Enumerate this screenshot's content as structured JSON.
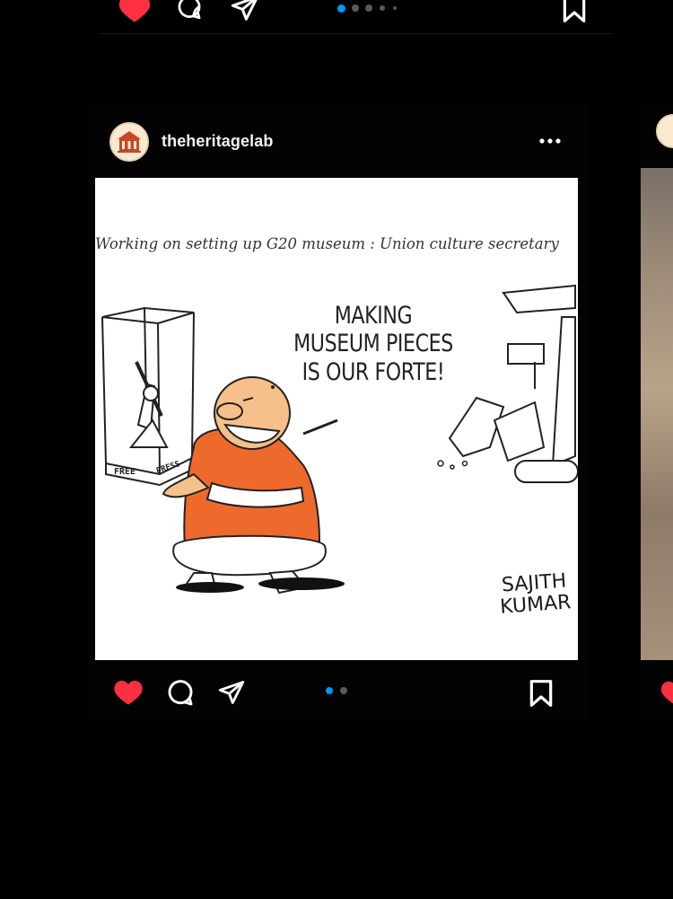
{
  "top_strip": {
    "icons": [
      "heart-icon",
      "comment-icon",
      "share-icon",
      "bookmark-icon"
    ],
    "carousel_dots": 5
  },
  "post": {
    "username": "theheritagelab",
    "menu_icon": "more-horizontal-icon",
    "image": {
      "headline": "Working on setting up G20 museum : Union culture secretary",
      "speech_bubble": [
        "MAKING",
        "MUSEUM PIECES",
        "IS OUR FORTE!"
      ],
      "box_labels": [
        "FREE",
        "PRESS"
      ],
      "signature": [
        "SAJITH",
        "KUMAR"
      ]
    },
    "actions": {
      "like_icon": "heart-filled-icon",
      "comment_icon": "comment-icon",
      "share_icon": "send-icon",
      "save_icon": "bookmark-icon"
    },
    "carousel_dots": 2,
    "active_dot": 0
  },
  "colors": {
    "background": "#000000",
    "like_red": "#ff3040",
    "dot_active": "#0095f6",
    "dot_inactive": "#5a5a5a",
    "avatar_bg": "#fbead0"
  }
}
